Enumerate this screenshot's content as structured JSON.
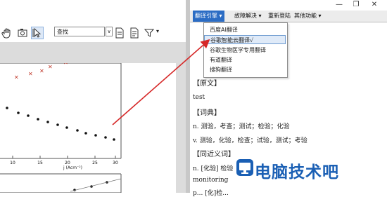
{
  "window": {
    "restore_glyph": "❐",
    "close_glyph": "✕"
  },
  "toolbar": {
    "search_placeholder": "查找",
    "icons": [
      "hand-icon",
      "snapshot-icon",
      "select-icon",
      "page-icon",
      "fit-icon",
      "filter-icon"
    ]
  },
  "menu": {
    "engine": "翻译引擎",
    "troubleshoot": "故障解决",
    "relogin": "重新登陆",
    "other": "其他功能",
    "dropdown_marker": "▾"
  },
  "dropdown": {
    "items": [
      "百度AI翻译",
      "谷歌智能云翻译√",
      "谷歌生物医学专用翻译",
      "有道翻译",
      "搜狗翻译"
    ],
    "selected_index": 1
  },
  "panel": {
    "original_heading": "【原文】",
    "original_text": "test",
    "dict_heading": "【词典】",
    "noun_def": "n. 测验，考查；测试；检验；化验",
    "verb_def": "v. 测验，化验，检查；试验，测试；考验",
    "synonym_heading": "【同近义词】",
    "synonym_line": "n. [化验] 检验",
    "monitoring_line": "monitoring",
    "partial_line": "p... [化]检..."
  },
  "chart_axis": {
    "ticks": [
      "10",
      "15",
      "20",
      "25",
      "30"
    ],
    "xlabel": "j (Acm⁻²)"
  },
  "watermark": {
    "text": "电脑技术吧"
  },
  "colors": {
    "menu_active": "#2b6cc4",
    "arrow": "#d62828",
    "watermark": "#1a5fb4"
  }
}
